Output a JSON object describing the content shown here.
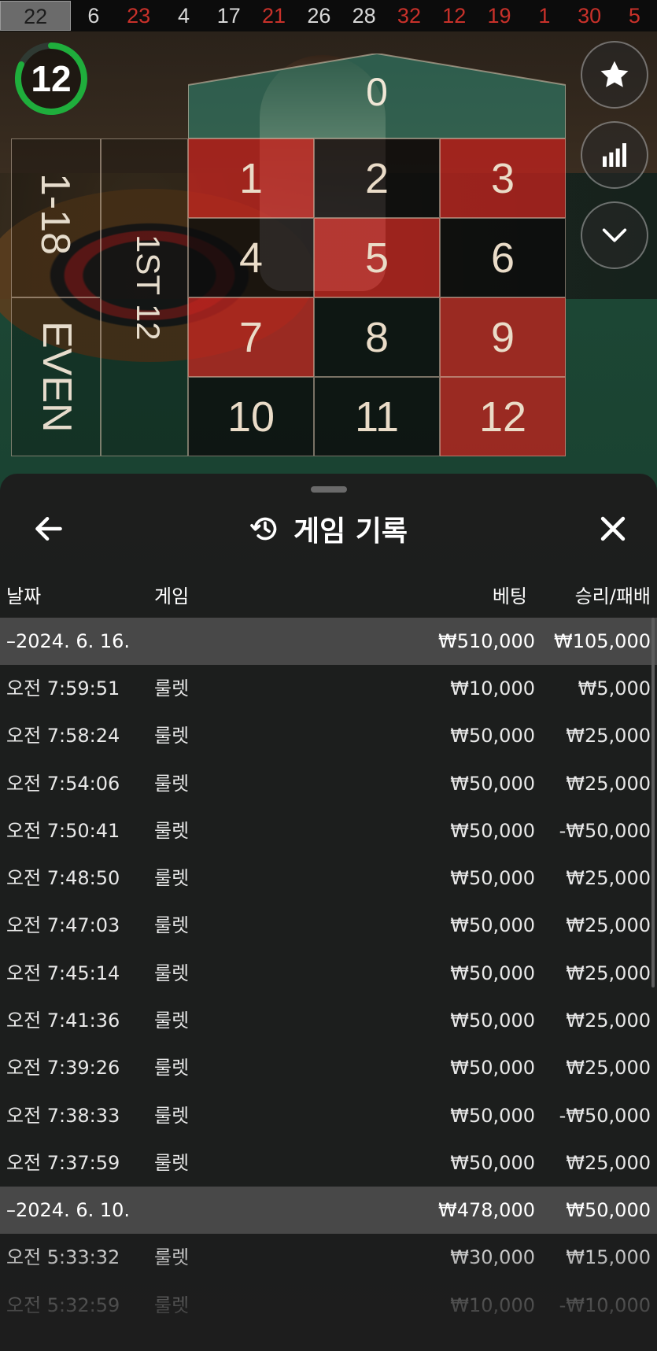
{
  "history_strip": [
    {
      "value": "22",
      "color": "black"
    },
    {
      "value": "6",
      "color": "black"
    },
    {
      "value": "23",
      "color": "red"
    },
    {
      "value": "4",
      "color": "black"
    },
    {
      "value": "17",
      "color": "black"
    },
    {
      "value": "21",
      "color": "red"
    },
    {
      "value": "26",
      "color": "black"
    },
    {
      "value": "28",
      "color": "black"
    },
    {
      "value": "32",
      "color": "red"
    },
    {
      "value": "12",
      "color": "red"
    },
    {
      "value": "19",
      "color": "red"
    },
    {
      "value": "1",
      "color": "red"
    },
    {
      "value": "30",
      "color": "red"
    },
    {
      "value": "5",
      "color": "red"
    }
  ],
  "timer": {
    "value": "12"
  },
  "side_buttons": [
    "star-icon",
    "stats-icon",
    "chevron-down-icon"
  ],
  "board": {
    "zero": "0",
    "dozen_label": "1ST 12",
    "outside_top": "1-18",
    "outside_bottom": "EVEN",
    "numbers": [
      {
        "n": "1",
        "c": "r"
      },
      {
        "n": "2",
        "c": "b"
      },
      {
        "n": "3",
        "c": "r"
      },
      {
        "n": "4",
        "c": "b"
      },
      {
        "n": "5",
        "c": "r"
      },
      {
        "n": "6",
        "c": "b"
      },
      {
        "n": "7",
        "c": "r"
      },
      {
        "n": "8",
        "c": "b"
      },
      {
        "n": "9",
        "c": "r"
      },
      {
        "n": "10",
        "c": "b"
      },
      {
        "n": "11",
        "c": "b"
      },
      {
        "n": "12",
        "c": "r"
      }
    ],
    "colors": {
      "red": "#be221e",
      "black": "#0a0a0a",
      "felt": "#1c4634"
    }
  },
  "panel": {
    "title": "게임 기록",
    "title_icon": "history-icon",
    "back_icon": "back-arrow-icon",
    "close_icon": "close-icon",
    "headers": {
      "date": "날짜",
      "game": "게임",
      "bet": "베팅",
      "result": "승리/패배"
    },
    "groups": [
      {
        "date": "–2024. 6. 16.",
        "total_bet": "₩510,000",
        "total_result": "₩105,000",
        "rows": [
          {
            "time": "오전 7:59:51",
            "game": "룰렛",
            "bet": "₩10,000",
            "result": "₩5,000"
          },
          {
            "time": "오전 7:58:24",
            "game": "룰렛",
            "bet": "₩50,000",
            "result": "₩25,000"
          },
          {
            "time": "오전 7:54:06",
            "game": "룰렛",
            "bet": "₩50,000",
            "result": "₩25,000"
          },
          {
            "time": "오전 7:50:41",
            "game": "룰렛",
            "bet": "₩50,000",
            "result": "-₩50,000"
          },
          {
            "time": "오전 7:48:50",
            "game": "룰렛",
            "bet": "₩50,000",
            "result": "₩25,000"
          },
          {
            "time": "오전 7:47:03",
            "game": "룰렛",
            "bet": "₩50,000",
            "result": "₩25,000"
          },
          {
            "time": "오전 7:45:14",
            "game": "룰렛",
            "bet": "₩50,000",
            "result": "₩25,000"
          },
          {
            "time": "오전 7:41:36",
            "game": "룰렛",
            "bet": "₩50,000",
            "result": "₩25,000"
          },
          {
            "time": "오전 7:39:26",
            "game": "룰렛",
            "bet": "₩50,000",
            "result": "₩25,000"
          },
          {
            "time": "오전 7:38:33",
            "game": "룰렛",
            "bet": "₩50,000",
            "result": "-₩50,000"
          },
          {
            "time": "오전 7:37:59",
            "game": "룰렛",
            "bet": "₩50,000",
            "result": "₩25,000"
          }
        ]
      },
      {
        "date": "–2024. 6. 10.",
        "total_bet": "₩478,000",
        "total_result": "₩50,000",
        "rows": [
          {
            "time": "오전 5:33:32",
            "game": "룰렛",
            "bet": "₩30,000",
            "result": "₩15,000"
          },
          {
            "time": "오전 5:32:59",
            "game": "룰렛",
            "bet": "₩10,000",
            "result": "-₩10,000"
          }
        ]
      }
    ]
  }
}
